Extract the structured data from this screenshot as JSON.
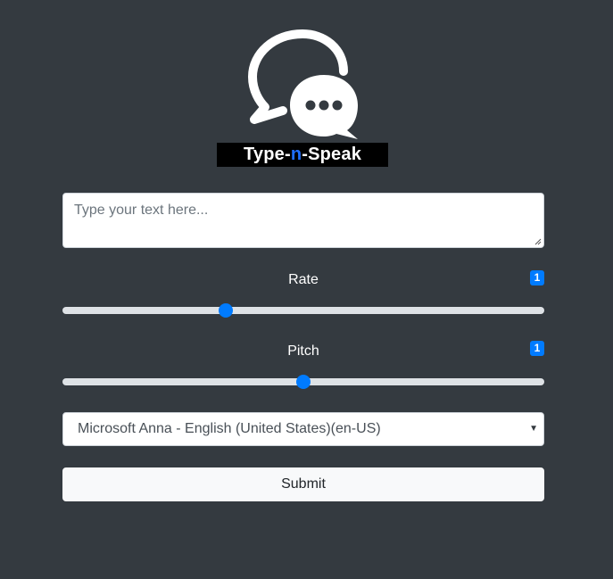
{
  "logo": {
    "text_before": "Type-",
    "text_accent": "n",
    "text_after": "-Speak"
  },
  "text_input": {
    "placeholder": "Type your text here...",
    "value": ""
  },
  "rate": {
    "label": "Rate",
    "badge": "1",
    "value": 1,
    "min": 0.5,
    "max": 2
  },
  "pitch": {
    "label": "Pitch",
    "badge": "1",
    "value": 1,
    "min": 0,
    "max": 2
  },
  "voice_select": {
    "selected": "Microsoft Anna - English (United States)(en-US)"
  },
  "submit": {
    "label": "Submit"
  },
  "colors": {
    "background": "#343a40",
    "accent": "#007bff",
    "logo_accent": "#1f6fff"
  }
}
